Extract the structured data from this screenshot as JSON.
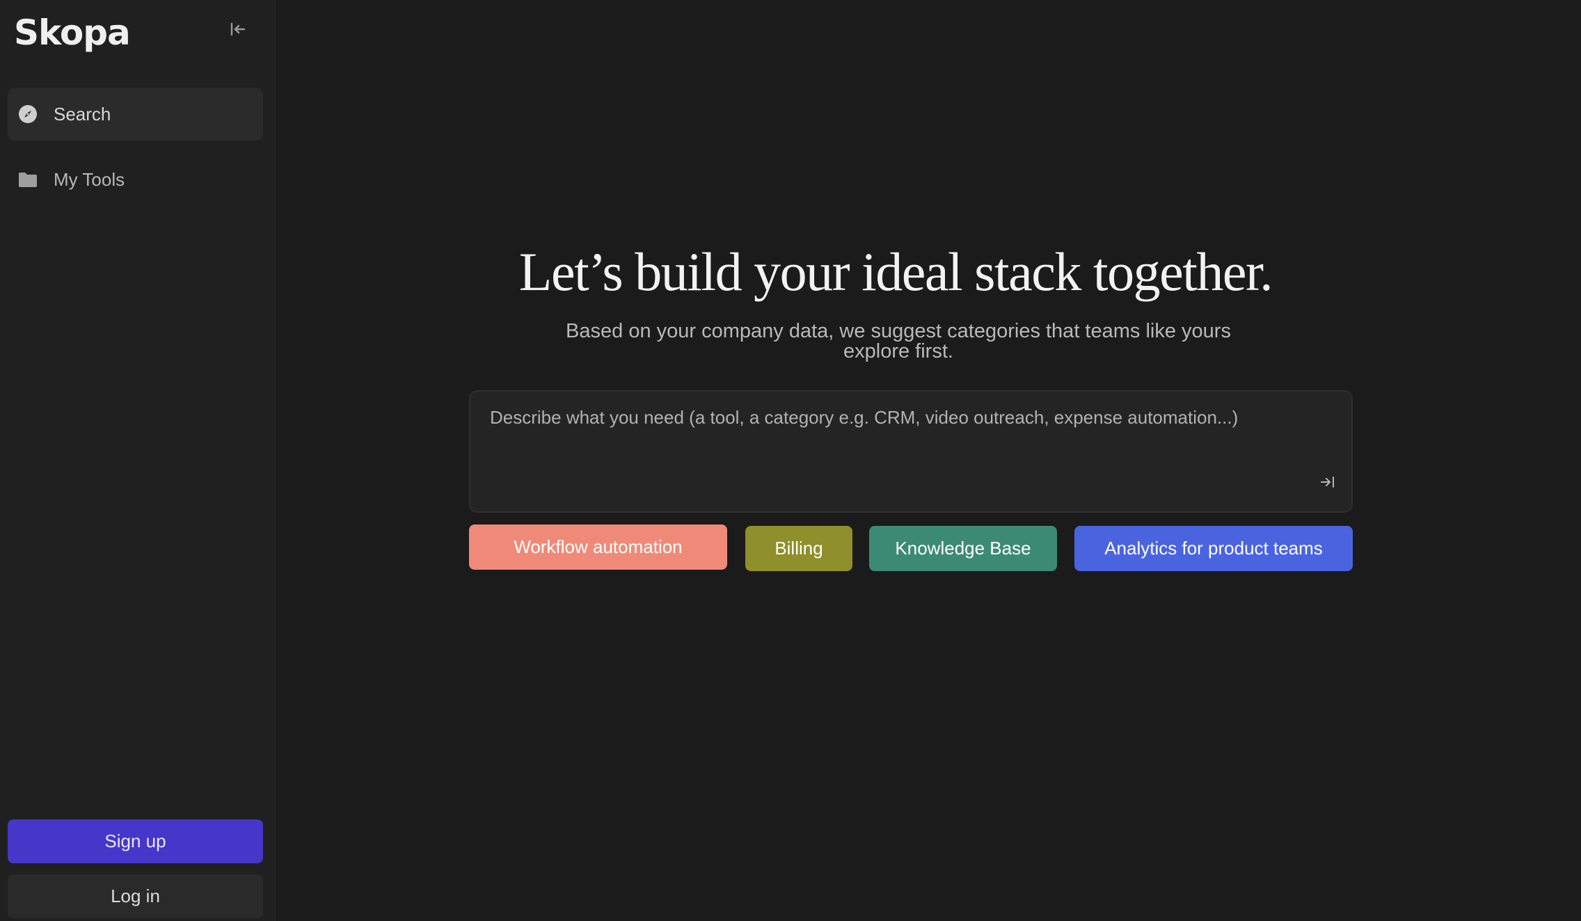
{
  "app": {
    "name": "Skopa"
  },
  "sidebar": {
    "collapse_icon": "collapse-left-icon",
    "items": [
      {
        "label": "Search",
        "icon": "compass-icon",
        "active": true
      },
      {
        "label": "My Tools",
        "icon": "folder-icon",
        "active": false
      }
    ],
    "signup_label": "Sign up",
    "login_label": "Log in"
  },
  "main": {
    "headline": "Let’s build your ideal stack together.",
    "subtitle": "Based on your company data, we suggest categories that teams like yours explore first.",
    "prompt": {
      "placeholder": "Describe what you need (a tool, a category e.g. CRM, video outreach, expense automation...)",
      "value": "",
      "submit_icon": "arrow-right-to-line-icon"
    },
    "suggestions": [
      {
        "label": "Workflow automation",
        "bg": "#f08a78",
        "fg": "#ffffff"
      },
      {
        "label": "Billing",
        "bg": "#8f8f2c",
        "fg": "#ffffff"
      },
      {
        "label": "Knowledge Base",
        "bg": "#3d8a72",
        "fg": "#ffffff"
      },
      {
        "label": "Analytics for product teams",
        "bg": "#4a64e0",
        "fg": "#ffffff"
      }
    ]
  },
  "colors": {
    "background": "#1b1b1b",
    "sidebar": "#202020",
    "signup_button": "#4636c9",
    "login_button": "#2a2a2a"
  }
}
